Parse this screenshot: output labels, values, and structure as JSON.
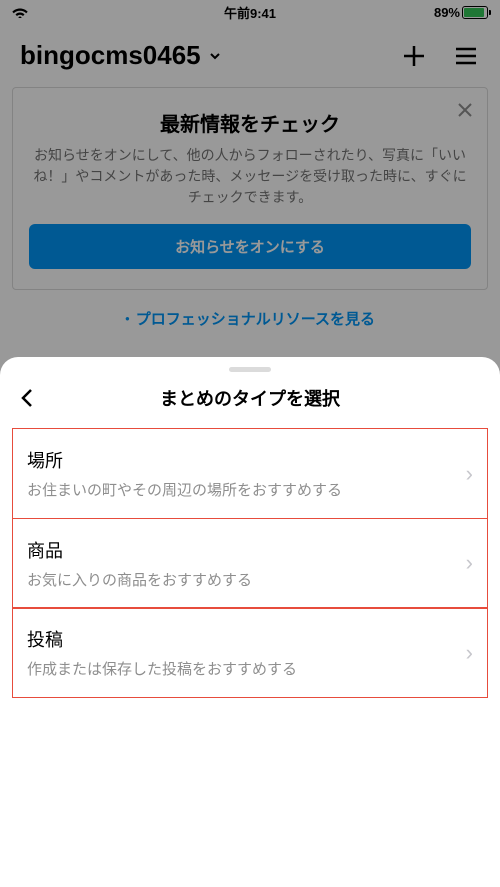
{
  "status": {
    "time": "午前9:41",
    "battery_pct": "89%"
  },
  "profile": {
    "username": "bingocms0465"
  },
  "notification": {
    "title": "最新情報をチェック",
    "description": "お知らせをオンにして、他の人からフォローされたり、写真に「いいね！」やコメントがあった時、メッセージを受け取った時に、すぐにチェックできます。",
    "button": "お知らせをオンにする"
  },
  "pro_link": "プロフェッショナルリソースを見る",
  "sheet": {
    "title": "まとめのタイプを選択",
    "options": [
      {
        "title": "場所",
        "description": "お住まいの町やその周辺の場所をおすすめする"
      },
      {
        "title": "商品",
        "description": "お気に入りの商品をおすすめする"
      },
      {
        "title": "投稿",
        "description": "作成または保存した投稿をおすすめする"
      }
    ]
  }
}
